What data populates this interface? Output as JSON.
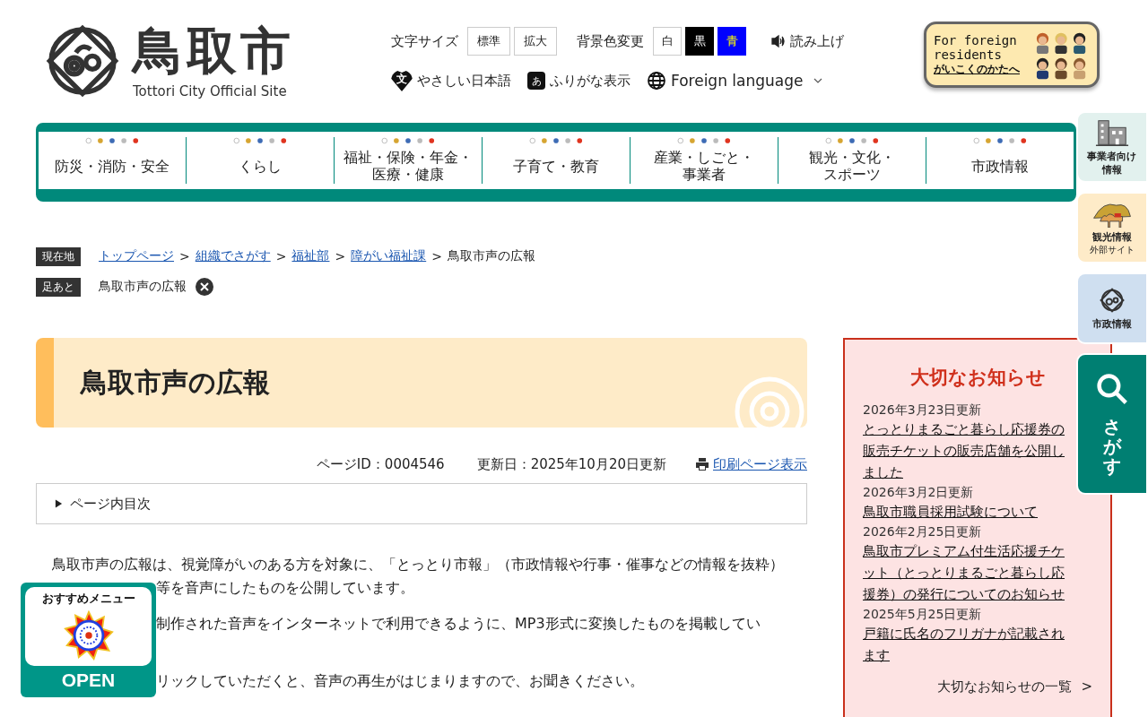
{
  "header": {
    "logo": {
      "title": "鳥取市",
      "subtitle": "Tottori City Official Site"
    },
    "font_size": {
      "label": "文字サイズ",
      "options": [
        {
          "label": "標準"
        },
        {
          "label": "拡大"
        }
      ]
    },
    "background_color": {
      "label": "背景色変更",
      "options": [
        {
          "label": "白",
          "kind": "white"
        },
        {
          "label": "黒",
          "kind": "black"
        },
        {
          "label": "青",
          "kind": "blue"
        }
      ]
    },
    "read_aloud": "読み上げ",
    "easy_japanese": {
      "icon": "文",
      "label": "やさしい日本語"
    },
    "furigana": {
      "icon": "あ",
      "label": "ふりがな表示"
    },
    "foreign_language": "Foreign language",
    "foreign_residents": {
      "line_1": "For foreign",
      "line_2": "residents",
      "link": "がいこくのかたへ"
    }
  },
  "nav": [
    "防災・消防・安全",
    "くらし",
    "福祉・保険・年金・医療・健康",
    "子育て・教育",
    "産業・しごと・事業者",
    "観光・文化・スポーツ",
    "市政情報"
  ],
  "side_tabs": [
    {
      "kind": "business",
      "label": "事業者向け情報"
    },
    {
      "kind": "tourism",
      "label": "観光情報",
      "sub": "外部サイト"
    },
    {
      "kind": "city",
      "label": "市政情報"
    },
    {
      "kind": "search",
      "label": "さがす"
    }
  ],
  "breadcrumb": {
    "label": "現在地",
    "separator": ">",
    "links": [
      "トップページ",
      "組織でさがす",
      "福祉部",
      "障がい福祉課"
    ],
    "current": "鳥取市声の広報"
  },
  "footprint": {
    "label": "足あと",
    "items": [
      "鳥取市声の広報"
    ]
  },
  "page_title": "鳥取市声の広報",
  "meta": {
    "page_id": "ページID：0004546",
    "updated": "更新日：2025年10月20日更新",
    "print": "印刷ページ表示"
  },
  "toc": {
    "label": "ページ内目次",
    "expanded": false
  },
  "body_lines": [
    "鳥取市声の広報は、視覚障がいのある方を対象に、「とっとり市報」（市政情報や行事・催事などの情報を抜粋）",
    "等を音声にしたものを公開しています。",
    "制作された音声をインターネットで利用できるように、MP3形式に変換したものを掲載してい",
    "リックしていただくと、音声の再生がはじまりますので、お聞きください。"
  ],
  "recommend": {
    "title": "おすすめメニュー",
    "button": "OPEN"
  },
  "notices": {
    "title": "大切なお知らせ",
    "items": [
      {
        "date": "2026年3月23日更新",
        "title": "とっとりまるごと暮らし応援券の販売チケットの販売店舗を公開しました"
      },
      {
        "date": "2026年3月2日更新",
        "title": "鳥取市職員採用試験について"
      },
      {
        "date": "2026年2月25日更新",
        "title": "鳥取市プレミアム付生活応援チケット（とっとりまるごと暮らし応援券）の発行についてのお知らせ"
      },
      {
        "date": "2025年5月25日更新",
        "title": "戸籍に氏名のフリガナが記載されます"
      }
    ],
    "more": "大切なお知らせの一覧",
    "more_icon": ">"
  }
}
